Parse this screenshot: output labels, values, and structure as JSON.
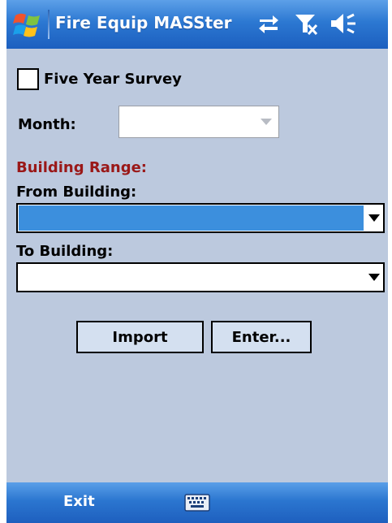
{
  "titlebar": {
    "app_title": "Fire Equip MASSter",
    "icons": [
      "windows-start-icon",
      "sync-icon",
      "signal-off-icon",
      "volume-icon"
    ]
  },
  "survey": {
    "checkbox_label": "Five Year Survey",
    "checked": false
  },
  "month": {
    "label": "Month:",
    "value": ""
  },
  "building_range": {
    "heading": "Building Range:",
    "heading_color": "#9a1818",
    "from_label": "From Building:",
    "from_value": "",
    "to_label": "To Building:",
    "to_value": ""
  },
  "buttons": {
    "import_label": "Import",
    "enter_label": "Enter..."
  },
  "menubar": {
    "left_softkey": "Exit",
    "input_icon": "keyboard-icon"
  },
  "colors": {
    "titlebar_blue": "#2c78d2",
    "background": "#bcc9de",
    "selection_blue": "#3c8fdd"
  }
}
